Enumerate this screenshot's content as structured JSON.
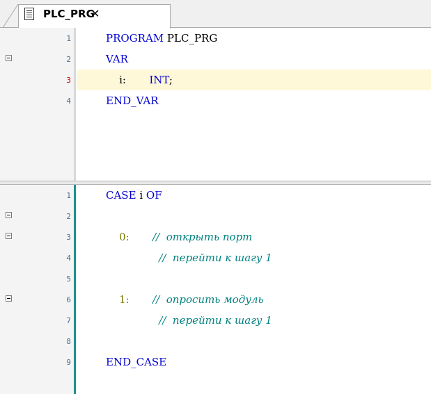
{
  "tab": {
    "title": "PLC_PRG",
    "close_glyph": "✕",
    "icon": "document-icon"
  },
  "declaration": {
    "lines": [
      {
        "num": "1",
        "fold": false,
        "tokens": [
          {
            "t": "kw",
            "v": "PROGRAM "
          },
          {
            "t": "txt",
            "v": "PLC_PRG"
          }
        ]
      },
      {
        "num": "2",
        "fold": true,
        "tokens": [
          {
            "t": "kw",
            "v": "VAR"
          }
        ]
      },
      {
        "num": "3",
        "fold": false,
        "current": true,
        "tokens": [
          {
            "t": "txt",
            "v": "    i:"
          },
          {
            "t": "kw",
            "v": "       INT"
          },
          {
            "t": "txt",
            "v": ";"
          }
        ]
      },
      {
        "num": "4",
        "fold": false,
        "tokens": [
          {
            "t": "kw",
            "v": "END_VAR"
          }
        ]
      }
    ]
  },
  "implementation": {
    "lines": [
      {
        "num": "1",
        "fold": false,
        "tokens": [
          {
            "t": "kw",
            "v": "CASE "
          },
          {
            "t": "txt",
            "v": "i "
          },
          {
            "t": "kw",
            "v": "OF"
          }
        ]
      },
      {
        "num": "2",
        "fold": true,
        "tokens": []
      },
      {
        "num": "3",
        "fold": true,
        "tokens": [
          {
            "t": "num",
            "v": "    0:"
          },
          {
            "t": "cm",
            "v": "       //  открыть порт"
          }
        ]
      },
      {
        "num": "4",
        "fold": false,
        "tokens": [
          {
            "t": "cm",
            "v": "                //  перейти к шагу 1"
          }
        ]
      },
      {
        "num": "5",
        "fold": false,
        "tokens": []
      },
      {
        "num": "6",
        "fold": true,
        "tokens": [
          {
            "t": "num",
            "v": "    1:"
          },
          {
            "t": "cm",
            "v": "       //  опросить модуль"
          }
        ]
      },
      {
        "num": "7",
        "fold": false,
        "tokens": [
          {
            "t": "cm",
            "v": "                //  перейти к шагу 1"
          }
        ]
      },
      {
        "num": "8",
        "fold": false,
        "tokens": []
      },
      {
        "num": "9",
        "fold": false,
        "tokens": [
          {
            "t": "kw",
            "v": "END_CASE"
          }
        ]
      }
    ]
  },
  "colors": {
    "keyword": "#0000d0",
    "identifier": "#000000",
    "number": "#7a7a00",
    "comment": "#008080",
    "line_number": "#4a6c8a",
    "line_number_current": "#c00000",
    "current_line_bg": "#fff8d8",
    "decl_gutter_border": "#d8d8d8",
    "impl_gutter_border": "#1f8f8f"
  }
}
